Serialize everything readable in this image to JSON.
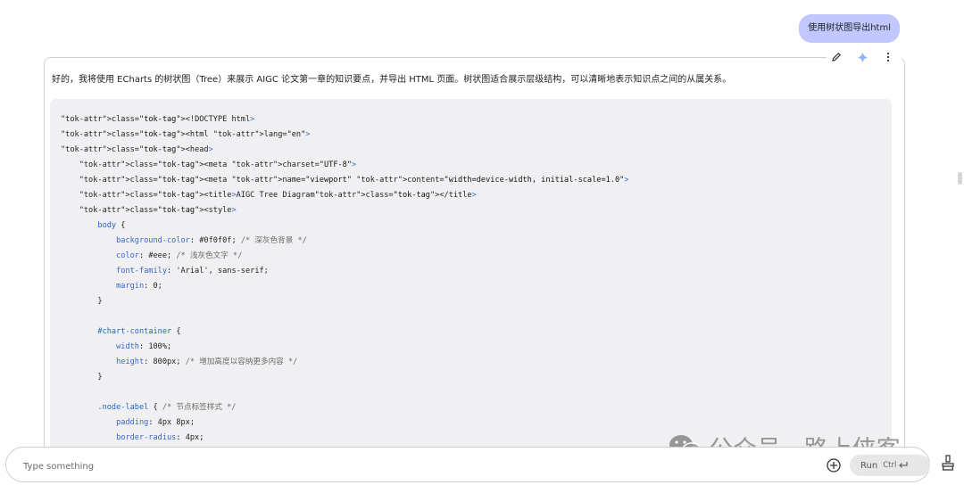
{
  "chat": {
    "user_message": "使用树状图导出html",
    "response_text": "好的，我将使用 ECharts 的树状图（Tree）来展示 AIGC 论文第一章的知识要点，并导出 HTML 页面。树状图适合展示层级结构，可以清晰地表示知识点之间的从属关系。"
  },
  "toolbar_icons": [
    "pencil-icon",
    "sparkle-icon",
    "more-vert-icon"
  ],
  "code": {
    "lines": [
      "<!DOCTYPE html>",
      "<html lang=\"en\">",
      "<head>",
      "    <meta charset=\"UTF-8\">",
      "    <meta name=\"viewport\" content=\"width=device-width, initial-scale=1.0\">",
      "    <title>AIGC Tree Diagram</title>",
      "    <style>",
      "        body {",
      "            background-color: #0f0f0f; /* 深灰色背景 */",
      "            color: #eee; /* 浅灰色文字 */",
      "            font-family: 'Arial', sans-serif;",
      "            margin: 0;",
      "        }",
      "",
      "        #chart-container {",
      "            width: 100%;",
      "            height: 800px; /* 增加高度以容纳更多内容 */",
      "        }",
      "",
      "        .node-label { /* 节点标签样式 */",
      "            padding: 4px 8px;",
      "            border-radius: 4px;"
    ]
  },
  "input": {
    "placeholder": "Type something",
    "run_label": "Run",
    "run_shortcut": "Ctrl"
  },
  "watermark": {
    "text": "公众号 · 路上侠客"
  },
  "colors": {
    "user_bubble": "#c2c8ff",
    "code_bg": "#f0f0f3",
    "sparkle": "#8ab4f8"
  }
}
